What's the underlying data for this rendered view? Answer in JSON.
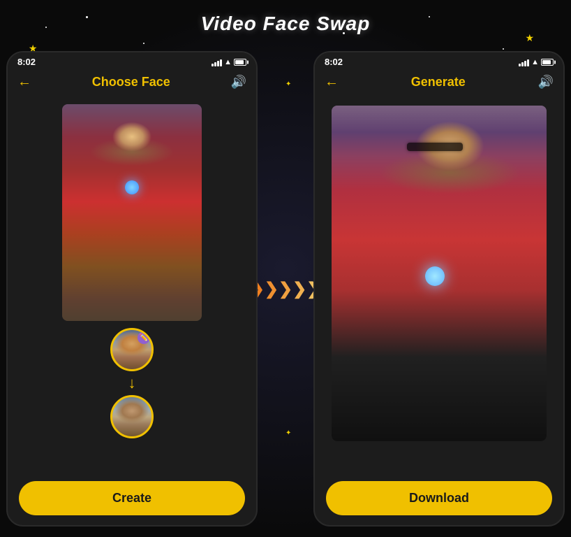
{
  "page": {
    "title": "Video Face Swap",
    "background_color": "#0a0a0a"
  },
  "left_phone": {
    "status_bar": {
      "time": "8:02"
    },
    "header": {
      "title": "Choose Face",
      "back_label": "←",
      "sound_icon": "🔊"
    },
    "create_button_label": "Create"
  },
  "right_phone": {
    "status_bar": {
      "time": "8:02"
    },
    "header": {
      "title": "Generate",
      "back_label": "←",
      "sound_icon": "🔊"
    },
    "download_button_label": "Download"
  },
  "arrow": {
    "symbols": "❯❯❯❯❯"
  }
}
